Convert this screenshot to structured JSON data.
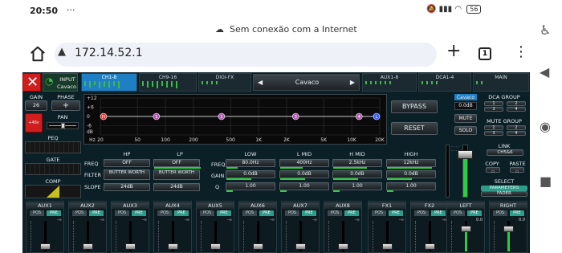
{
  "status": {
    "time": "20:50",
    "dots": "···",
    "battery": "56"
  },
  "connection": {
    "text": "Sem conexão com a Internet"
  },
  "browser": {
    "url": "172.14.52.1",
    "tab_count": "1"
  },
  "app": {
    "input_label": "INPUT",
    "input_name": "Cavaco",
    "tabs": [
      "CH1-8",
      "CH9-16",
      "DIGI-FX",
      "AUX1-8",
      "DCA1-4",
      "MAIN"
    ],
    "channel_select": "Cavaco",
    "gain_label": "GAIN",
    "phase_label": "PHASE",
    "gain_value": "26",
    "phase_symbol": "+",
    "phantom_label": "+48v",
    "pan_label": "PAN",
    "peq_label": "PEQ",
    "gate_label": "GATE",
    "comp_label": "COMP",
    "eq_y_labels": [
      "+12",
      "+6",
      "0",
      "-6",
      "dB"
    ],
    "eq_x_labels": [
      "Hz",
      "20",
      "50",
      "100",
      "200",
      "500",
      "1K",
      "2K",
      "5K",
      "10K",
      "20K"
    ],
    "eq_points": [
      {
        "label": "H",
        "freq_hz": 20,
        "gain_db": 0,
        "color": "#e23b3b"
      },
      {
        "label": "1",
        "freq_hz": 80,
        "gain_db": 0,
        "color": "#b05bb0"
      },
      {
        "label": "2",
        "freq_hz": 400,
        "gain_db": 0,
        "color": "#b05bb0"
      },
      {
        "label": "3",
        "freq_hz": 2500,
        "gain_db": 0,
        "color": "#b05bb0"
      },
      {
        "label": "4",
        "freq_hz": 12000,
        "gain_db": 0,
        "color": "#b05bb0"
      },
      {
        "label": "L",
        "freq_hz": 20000,
        "gain_db": 0,
        "color": "#3c5bff"
      }
    ],
    "bypass_label": "BYPASS",
    "reset_label": "RESET",
    "filters": {
      "hp_label": "HP",
      "lp_label": "LP",
      "freq_label": "FREQ",
      "filter_label": "FILTER",
      "slope_label": "SLOPE",
      "hp_freq": "OFF",
      "lp_freq": "OFF",
      "hp_filter": "BUTTER WORTH",
      "lp_filter": "BUTTER WORTH",
      "hp_slope": "24dB",
      "lp_slope": "24dB"
    },
    "eq_bands": {
      "row_labels": [
        "FREQ",
        "GAIN",
        "Q"
      ],
      "bands": [
        {
          "name": "LOW",
          "freq": "80.0Hz",
          "gain": "0.0dB",
          "q": "1.00"
        },
        {
          "name": "L MID",
          "freq": "400Hz",
          "gain": "0.0dB",
          "q": "1.00"
        },
        {
          "name": "H MID",
          "freq": "2.5kHz",
          "gain": "0.0dB",
          "q": "1.00"
        },
        {
          "name": "HIGH",
          "freq": "12kHz",
          "gain": "0.0dB",
          "q": "1.00"
        }
      ]
    },
    "channel_strip": {
      "name": "Cavaco",
      "level": "0.0dB",
      "mute": "MUTE",
      "solo": "SOLO"
    },
    "dca_group_label": "DCA GROUP",
    "dca_buttons": [
      "1",
      "2",
      "3",
      "4"
    ],
    "mute_group_label": "MUTE GROUP",
    "mute_buttons": [
      "1",
      "2",
      "3",
      "4"
    ],
    "link_label": "LINK",
    "link_value": "CH5&6",
    "copy_label": "COPY",
    "paste_label": "PASTE",
    "select_label": "SELECT",
    "parameters_label": "PARAMETERS",
    "fader_label": "FADER",
    "auxes": [
      {
        "name": "AUX1"
      },
      {
        "name": "AUX2"
      },
      {
        "name": "AUX3"
      },
      {
        "name": "AUX4"
      },
      {
        "name": "AUX5"
      },
      {
        "name": "AUX6"
      },
      {
        "name": "AUX7"
      },
      {
        "name": "AUX8"
      },
      {
        "name": "FX1"
      },
      {
        "name": "FX2"
      },
      {
        "name": "LEFT"
      },
      {
        "name": "RIGHT"
      }
    ],
    "pos_label": "POS",
    "pre_label": "PRE",
    "inf_label": "-∞",
    "lr_level": "0.0"
  }
}
